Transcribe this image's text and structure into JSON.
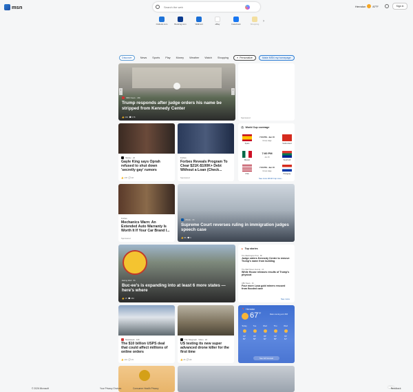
{
  "header": {
    "logo_text": "msn",
    "search_placeholder": "Search the web",
    "location": "Herndon",
    "temperature": "87°F",
    "signin_label": "Sign in"
  },
  "quick_links": [
    {
      "label": "Outlook.com",
      "color": "#1e73d8"
    },
    {
      "label": "Booking.com",
      "color": "#0b3b8f"
    },
    {
      "label": "Walmart",
      "color": "#1a6fd6"
    },
    {
      "label": "eBay",
      "color": "#e53238"
    },
    {
      "label": "Facebook",
      "color": "#1877f2"
    },
    {
      "label": "Shopping",
      "color": "#f2c94c"
    }
  ],
  "tabs": [
    "Discover",
    "News",
    "Sports",
    "Play",
    "Money",
    "Weather",
    "Watch",
    "Shopping"
  ],
  "personalize_label": "Personalize",
  "homepage_label": "Make MSN my homepage",
  "hero": {
    "source": "NBC News · 18h",
    "title": "Trump responds after judge orders his name be stripped from Kennedy Center",
    "likes": "294",
    "comments": "478"
  },
  "sponsored_label": "Sponsored",
  "card_oprah": {
    "source": "Variety · 2d",
    "title": "Gayle King says Oprah refused to shut down 'secretly gay' rumors",
    "likes": "178",
    "comments": "48"
  },
  "card_forbes": {
    "source": "Forbes",
    "title": "Forbes Reveals Program To Clear $21K-$100K+ Debt Without a Loan (Check...",
    "sponsored": "Sponsored"
  },
  "world_cup": {
    "title": "World Cup coverage",
    "matches": [
      {
        "time": "7:00 PM · Jun 15",
        "sub": "Group stage",
        "left_team": "Spain",
        "right_team": "Switzerland",
        "left_color": "#c60b1e",
        "right_color": "#d52b1e"
      },
      {
        "time": "7:00 PM",
        "sub": "Jun 15",
        "left_team": "Mexico",
        "right_team": "South Afr",
        "left_color": "#006847",
        "right_color": "#007a4d"
      },
      {
        "time": "7:00 PM · Jun 15",
        "sub": "Group stage",
        "left_team": "USA",
        "right_team": "Paraguay",
        "left_color": "#b22234",
        "right_color": "#d52b1e"
      }
    ],
    "more_label": "See more World Cup cove..."
  },
  "card_mechanic": {
    "source": "Forbes",
    "title": "Mechanics Warn: An Extended Auto Warranty Is Worth It If Your Car Brand I...",
    "sponsored": "Sponsored"
  },
  "card_scotus": {
    "source": "WGAL · 6h",
    "title": "Supreme Court reverses ruling in immigration judges speech case",
    "likes": "86",
    "comments": "6"
  },
  "card_bucees": {
    "source": "Eating Well · 5h",
    "title": "Buc-ee's is expanding into at least 6 more states — here's where",
    "likes": "15",
    "comments": "260"
  },
  "top_stories": {
    "title": "Top stories",
    "items": [
      {
        "source": "The Washington Post · 8h",
        "title": "Judge orders Kennedy Center to remove Trump's name from building"
      },
      {
        "source": "The Wall Street Journal · 1h",
        "title": "White House releases results of Trump's physical"
      },
      {
        "source": "ABC News · 4h",
        "title": "Four more Lusa gold miners rescued from flooded cave"
      }
    ],
    "see_more": "See more"
  },
  "card_usps": {
    "source": "Newsweek · 12h",
    "title": "The $10 billion USPS deal that could affect millions of online orders",
    "likes": "131",
    "comments": "15"
  },
  "card_drone": {
    "source": "The Telegraph · Video · 2d",
    "title": "US testing its new super advanced drone killer for the first time",
    "likes": "26",
    "comments": "20"
  },
  "weather": {
    "location": "Herndon",
    "temp": "67",
    "unit": "°F",
    "note": "Rain coming at 4 PM",
    "days": [
      {
        "day": "Today",
        "hi": "72°",
        "lo": "56°"
      },
      {
        "day": "Tue",
        "hi": "75°",
        "lo": "58°"
      },
      {
        "day": "Wed",
        "hi": "78°",
        "lo": "60°"
      },
      {
        "day": "Thu",
        "hi": "74°",
        "lo": "58°"
      },
      {
        "day": "Wed",
        "hi": "79°",
        "lo": "61°"
      }
    ],
    "forecast_label": "See full forecast"
  },
  "footer": {
    "copyright": "© 2026 Microsoft",
    "privacy": "Your Privacy Choices",
    "consumer_privacy": "Consumer Health Privacy",
    "feedback": "Feedback"
  }
}
